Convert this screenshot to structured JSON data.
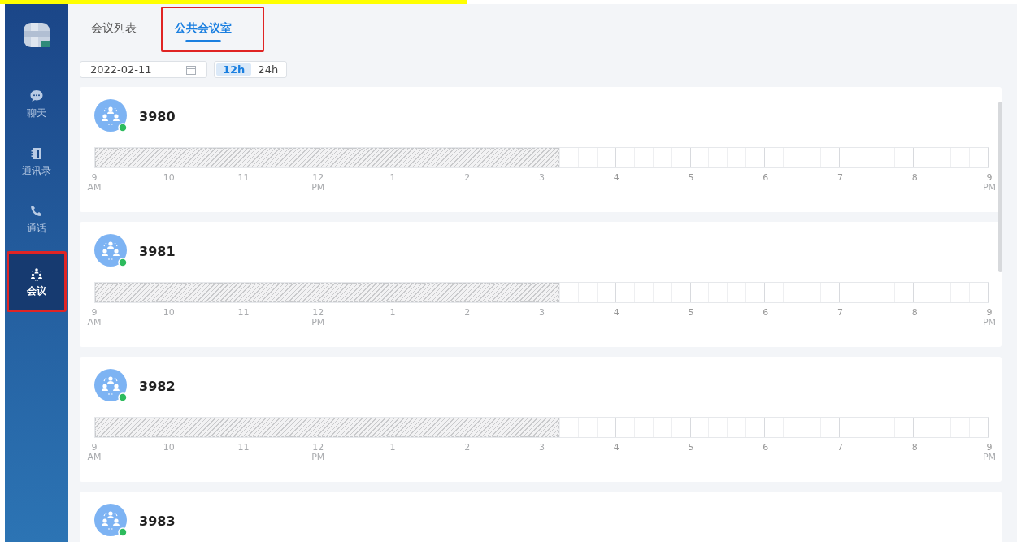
{
  "sidebar": {
    "items": [
      {
        "kind": "chat",
        "label": "聊天",
        "selected": false,
        "highlighted": false
      },
      {
        "kind": "contacts",
        "label": "通讯录",
        "selected": false,
        "highlighted": false
      },
      {
        "kind": "phone",
        "label": "通话",
        "selected": false,
        "highlighted": false
      },
      {
        "kind": "meeting",
        "label": "会议",
        "selected": true,
        "highlighted": true
      }
    ]
  },
  "tabs": [
    {
      "label": "会议列表",
      "selected": false,
      "highlighted": false
    },
    {
      "label": "公共会议室",
      "selected": true,
      "highlighted": true
    }
  ],
  "date_field": {
    "value": "2022-02-11"
  },
  "time_format": [
    {
      "label": "12h",
      "selected": true
    },
    {
      "label": "24h",
      "selected": false
    }
  ],
  "rooms": [
    {
      "name": "3980",
      "online": true,
      "level": 0.52,
      "ticks": [
        {
          "hour": "9",
          "period": "AM"
        },
        {
          "hour": "10"
        },
        {
          "hour": "11"
        },
        {
          "hour": "12",
          "period": "PM"
        },
        {
          "hour": "1"
        },
        {
          "hour": "2"
        },
        {
          "hour": "3"
        },
        {
          "hour": "4"
        },
        {
          "hour": "5"
        },
        {
          "hour": "6"
        },
        {
          "hour": "7"
        },
        {
          "hour": "8"
        },
        {
          "hour": "9",
          "period": "PM"
        }
      ]
    },
    {
      "name": "3981",
      "online": true,
      "level": 0.52,
      "ticks": [
        {
          "hour": "9",
          "period": "AM"
        },
        {
          "hour": "10"
        },
        {
          "hour": "11"
        },
        {
          "hour": "12",
          "period": "PM"
        },
        {
          "hour": "1"
        },
        {
          "hour": "2"
        },
        {
          "hour": "3"
        },
        {
          "hour": "4"
        },
        {
          "hour": "5"
        },
        {
          "hour": "6"
        },
        {
          "hour": "7"
        },
        {
          "hour": "8"
        },
        {
          "hour": "9",
          "period": "PM"
        }
      ]
    },
    {
      "name": "3982",
      "online": true,
      "level": 0.52,
      "ticks": [
        {
          "hour": "9",
          "period": "AM"
        },
        {
          "hour": "10"
        },
        {
          "hour": "11"
        },
        {
          "hour": "12",
          "period": "PM"
        },
        {
          "hour": "1"
        },
        {
          "hour": "2"
        },
        {
          "hour": "3"
        },
        {
          "hour": "4"
        },
        {
          "hour": "5"
        },
        {
          "hour": "6"
        },
        {
          "hour": "7"
        },
        {
          "hour": "8"
        },
        {
          "hour": "9",
          "period": "PM"
        }
      ]
    },
    {
      "name": "3983",
      "online": true
    }
  ]
}
